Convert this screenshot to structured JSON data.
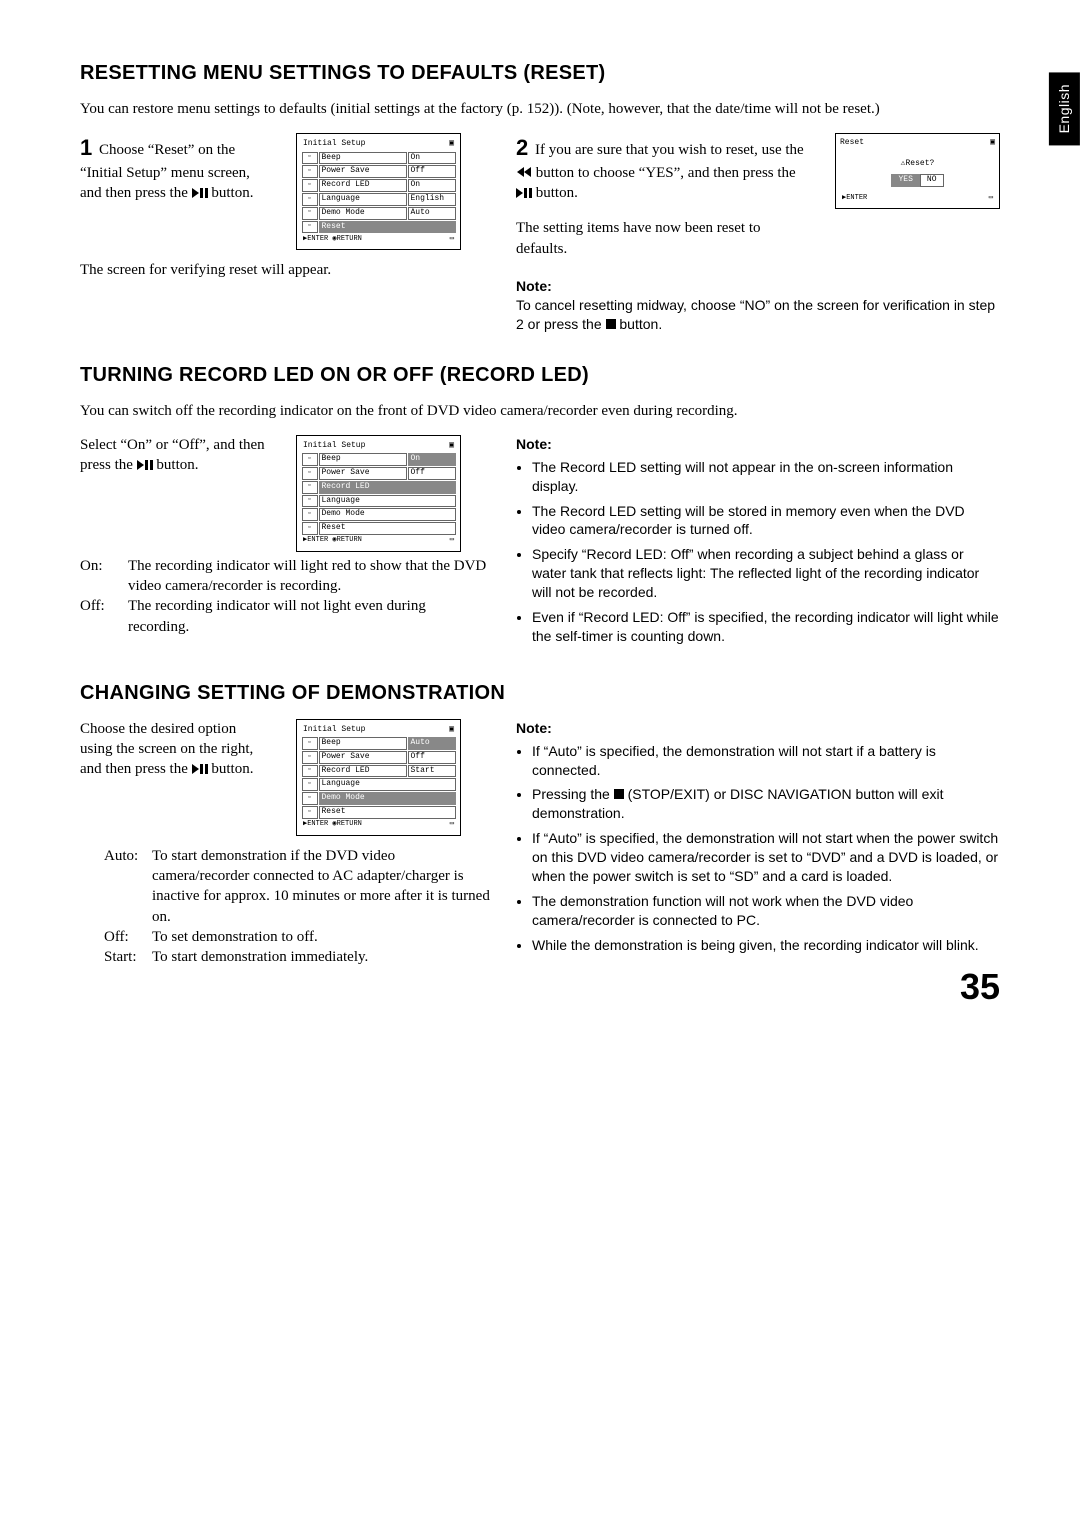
{
  "lang_tab": "English",
  "page_number": "35",
  "icons": {
    "play_pause": "play-pause",
    "rewind": "rewind",
    "stop": "stop",
    "warning": "warning",
    "camera": "camera"
  },
  "section1": {
    "heading": "RESETTING MENU SETTINGS TO DEFAULTS (RESET)",
    "intro": "You can restore menu settings to defaults (initial settings at the factory (p. 152)). (Note, however, that the date/time will not be reset.)",
    "step1_pre": "Choose “Reset” on the “Initial Setup” menu screen, and then press the ",
    "step1_post": " button.",
    "step1_caption": "The screen for verifying reset will appear.",
    "step2_a": "If you are sure that you wish to reset, use the ",
    "step2_b": " button to choose “YES”, and then press the ",
    "step2_c": " button.",
    "step2_caption": "The setting items have now been reset to defaults.",
    "note_label": "Note:",
    "note_text_a": "To cancel resetting midway, choose “NO” on the screen for verification in step 2 or press the ",
    "note_text_b": " button.",
    "osd1": {
      "title": "Initial Setup",
      "rows": [
        {
          "label": "Beep",
          "val": "On"
        },
        {
          "label": "Power Save",
          "val": "Off"
        },
        {
          "label": "Record LED",
          "val": "On"
        },
        {
          "label": "Language",
          "val": "English"
        },
        {
          "label": "Demo Mode",
          "val": "Auto"
        },
        {
          "label": "Reset",
          "val": ""
        }
      ],
      "highlight_index": 5,
      "foot_l": "ENTER",
      "foot_m": "RETURN",
      "foot_r": ""
    },
    "osd_dlg": {
      "title": "Reset",
      "prompt": "Reset?",
      "yes": "YES",
      "no": "NO",
      "foot": "ENTER"
    }
  },
  "section2": {
    "heading": "TURNING RECORD LED ON OR OFF (RECORD LED)",
    "intro": "You can switch off the recording indicator on the front of DVD video camera/recorder even during recording.",
    "body_a": "Select “On” or “Off”, and then press the ",
    "body_b": " button.",
    "on_label": "On:",
    "on_text": "The recording indicator will light red to show that the DVD video camera/recorder is recording.",
    "off_label": "Off:",
    "off_text": "The recording indicator will not light even during recording.",
    "note_label": "Note:",
    "notes": [
      "The Record LED setting will not appear in the on-screen information display.",
      "The Record LED setting will be stored in memory even when the DVD video camera/recorder is turned off.",
      "Specify “Record LED: Off” when recording a subject behind a glass or water tank that reflects light: The reflected light of the recording indicator will not be recorded.",
      "Even if “Record LED: Off” is specified, the recording indicator will light while the self-timer is counting down."
    ],
    "osd": {
      "title": "Initial Setup",
      "rows": [
        {
          "label": "Beep",
          "val": "On",
          "vhl": true
        },
        {
          "label": "Power Save",
          "val": "Off"
        },
        {
          "label": "Record LED",
          "val": ""
        },
        {
          "label": "Language",
          "val": ""
        },
        {
          "label": "Demo Mode",
          "val": ""
        },
        {
          "label": "Reset",
          "val": ""
        }
      ],
      "highlight_index": 2,
      "foot_l": "ENTER",
      "foot_m": "RETURN"
    }
  },
  "section3": {
    "heading": "CHANGING SETTING OF DEMONSTRATION",
    "body_a": "Choose the desired option using the screen on the right, and then press the ",
    "body_b": " button.",
    "auto_label": "Auto:",
    "auto_text": "To start demonstration if the DVD video camera/recorder connected to AC adapter/charger is inactive for approx. 10 minutes or more after it is turned on.",
    "off_label": "Off:",
    "off_text": "To set demonstration to off.",
    "start_label": "Start:",
    "start_text": "To start demonstration immediately.",
    "note_label": "Note:",
    "notes_pre_stop_a": "Pressing the ",
    "notes_pre_stop_b": " (STOP/EXIT) or DISC NAVIGATION button will exit demonstration.",
    "notes": [
      "If “Auto” is specified, the demonstration will not start if a battery is connected.",
      "__STOP_NOTE__",
      "If “Auto” is specified, the demonstration will not start when the power switch on this DVD video camera/recorder is set to “DVD” and a DVD is loaded, or when the power switch is set to “SD” and a card is loaded.",
      "The demonstration function will not work when the DVD video camera/recorder is connected to PC.",
      "While the demonstration is being given, the recording indicator will blink."
    ],
    "osd": {
      "title": "Initial Setup",
      "rows": [
        {
          "label": "Beep",
          "val": "Auto",
          "vhl": true
        },
        {
          "label": "Power Save",
          "val": "Off"
        },
        {
          "label": "Record LED",
          "val": "Start"
        },
        {
          "label": "Language",
          "val": ""
        },
        {
          "label": "Demo Mode",
          "val": ""
        },
        {
          "label": "Reset",
          "val": ""
        }
      ],
      "highlight_index": 4,
      "foot_l": "ENTER",
      "foot_m": "RETURN"
    }
  }
}
